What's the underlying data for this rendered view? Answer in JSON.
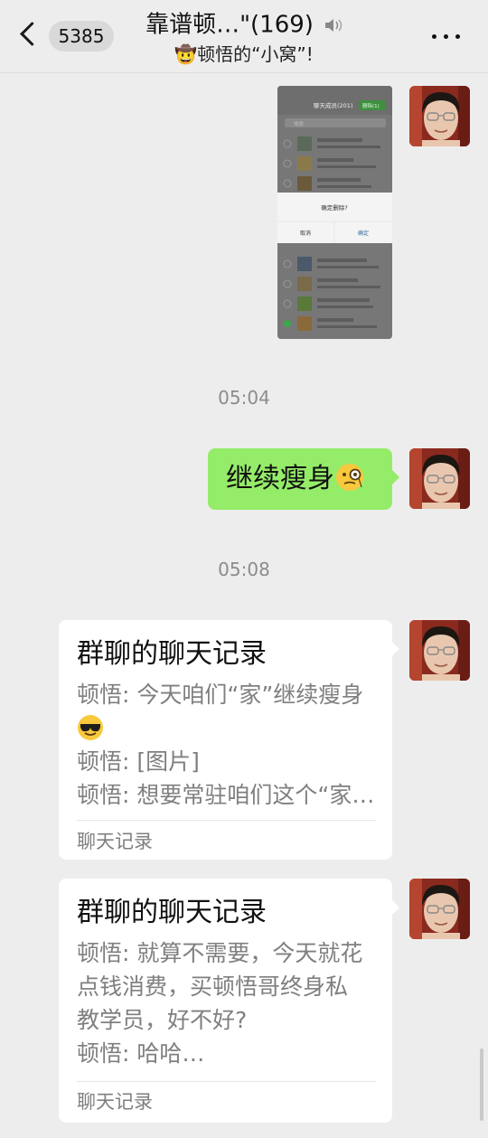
{
  "header": {
    "badge": "5385",
    "title": "靠谱顿…\"(169)",
    "subtitle": "🤠顿悟的“小窝”!",
    "mute_icon": "speaker-mute-icon",
    "more_icon": "more-icon"
  },
  "screenshot_image": {
    "header": "聊天成员(201)",
    "delete_button": "删除(1)",
    "search_placeholder": "搜索",
    "dialog_title": "确定删除?",
    "dialog_cancel": "取消",
    "dialog_confirm": "确定"
  },
  "messages": [
    {
      "kind": "time",
      "text": "05:04"
    },
    {
      "kind": "text",
      "text": "继续瘦身",
      "emoji": "face-with-monocle"
    },
    {
      "kind": "time",
      "text": "05:08"
    }
  ],
  "cards": [
    {
      "title": "群聊的聊天记录",
      "lines": [
        "顿悟: 今天咱们“家”继续瘦身",
        "顿悟: [图片]",
        "顿悟: 想要常驻咱们这个“家…"
      ],
      "emoji_line": "cool-face-emoji",
      "footer": "聊天记录"
    },
    {
      "title": "群聊的聊天记录",
      "lines": [
        "顿悟: 就算不需要，今天就花",
        "点钱消费，买顿悟哥终身私",
        "教学员，好不好?",
        "顿悟: 哈哈…"
      ],
      "footer": "聊天记录"
    }
  ],
  "colors": {
    "background": "#ededed",
    "own_bubble": "#95ec69",
    "card": "#ffffff",
    "secondary_text": "#7f7f7f"
  }
}
